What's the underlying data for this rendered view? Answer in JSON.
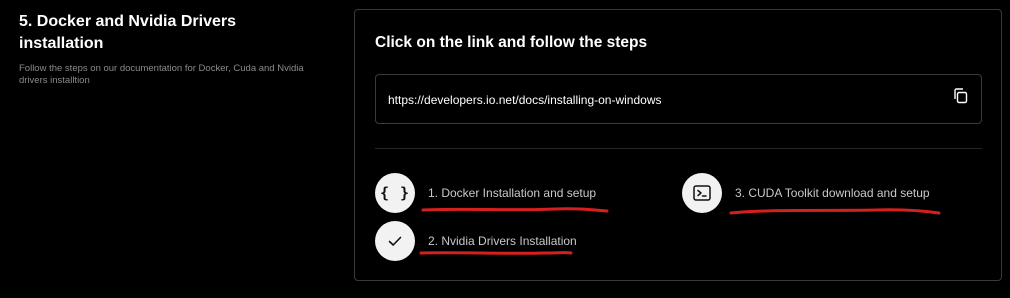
{
  "section": {
    "title": "5. Docker and Nvidia Drivers installation",
    "description": "Follow the steps on our documentation for Docker, Cuda and Nvidia drivers installtion"
  },
  "card": {
    "title": "Click on the link and follow the steps",
    "link": "https://developers.io.net/docs/installing-on-windows",
    "copy_icon": "copy-icon"
  },
  "steps": [
    {
      "label": "1. Docker Installation and setup",
      "icon": "braces-icon"
    },
    {
      "label": "2. Nvidia Drivers Installation",
      "icon": "check-icon"
    },
    {
      "label": "3. CUDA Toolkit download and setup",
      "icon": "terminal-icon"
    }
  ],
  "annotation_color": "#d61f1f"
}
